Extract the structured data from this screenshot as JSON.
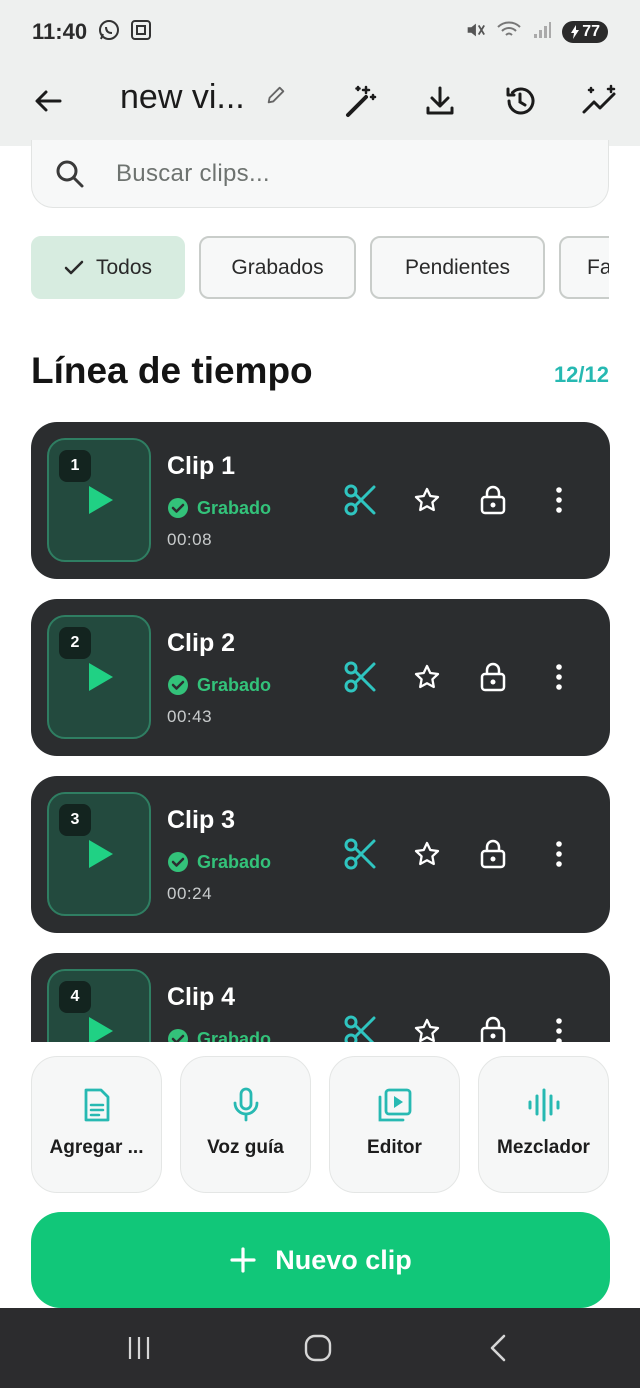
{
  "status_bar": {
    "time": "11:40",
    "battery": "77"
  },
  "top_bar": {
    "title": "new vi..."
  },
  "search": {
    "placeholder": "Buscar clips..."
  },
  "filters": [
    {
      "label": "Todos",
      "active": true
    },
    {
      "label": "Grabados",
      "active": false
    },
    {
      "label": "Pendientes",
      "active": false
    },
    {
      "label": "Fa",
      "active": false
    }
  ],
  "timeline": {
    "title": "Línea de tiempo",
    "count": "12/12"
  },
  "clips": [
    {
      "number": "1",
      "name": "Clip 1",
      "status": "Grabado",
      "duration": "00:08"
    },
    {
      "number": "2",
      "name": "Clip 2",
      "status": "Grabado",
      "duration": "00:43"
    },
    {
      "number": "3",
      "name": "Clip 3",
      "status": "Grabado",
      "duration": "00:24"
    },
    {
      "number": "4",
      "name": "Clip 4",
      "status": "Grabado",
      "duration": ""
    }
  ],
  "tools": [
    {
      "label": "Agregar ...",
      "icon": "document-icon"
    },
    {
      "label": "Voz guía",
      "icon": "microphone-icon"
    },
    {
      "label": "Editor",
      "icon": "video-library-icon"
    },
    {
      "label": "Mezclador",
      "icon": "waveform-icon"
    }
  ],
  "new_clip": {
    "label": "Nuevo clip"
  },
  "colors": {
    "accent": "#11c779",
    "teal": "#27b9b2",
    "card": "#2b2d2f",
    "success": "#33c27a"
  }
}
